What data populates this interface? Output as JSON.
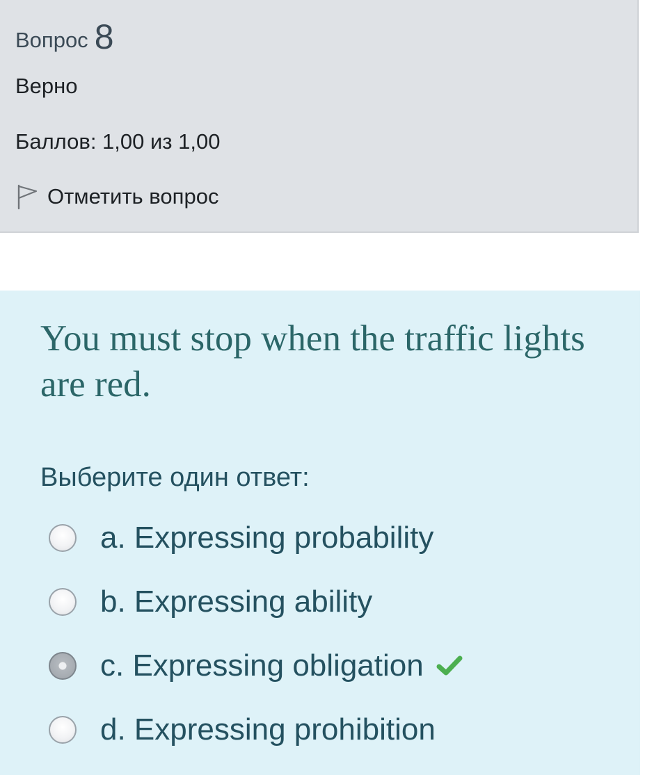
{
  "info": {
    "question_word": "Вопрос",
    "question_number": "8",
    "state": "Верно",
    "grade": "Баллов: 1,00 из 1,00",
    "flag_label": "Отметить вопрос",
    "flag_icon": "flag-outline-icon"
  },
  "content": {
    "question_text": "You must stop when the traffic lights are red.",
    "prompt": "Выберите один ответ:",
    "options": [
      {
        "label": "a. Expressing probability",
        "checked": false
      },
      {
        "label": "b. Expressing ability",
        "checked": false
      },
      {
        "label": "c. Expressing obligation",
        "checked": true,
        "correct_icon": "checkmark-icon"
      },
      {
        "label": "d. Expressing prohibition",
        "checked": false
      }
    ]
  },
  "colors": {
    "info_background": "#dfe2e6",
    "content_background": "#def2f8",
    "question_text": "#2b6668",
    "option_text": "#245160",
    "correct_check": "#4caf50"
  }
}
